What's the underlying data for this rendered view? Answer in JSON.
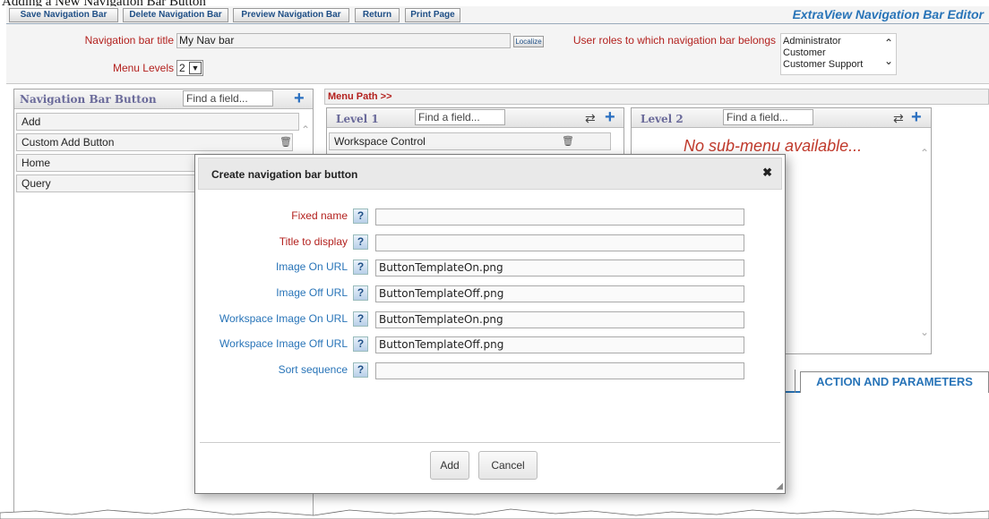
{
  "caption": "Adding a New Navigation Bar Button",
  "toolbar": {
    "buttons": [
      "Save Navigation Bar",
      "Delete Navigation Bar",
      "Preview Navigation Bar",
      "Return",
      "Print Page"
    ],
    "title": "ExtraView Navigation Bar Editor"
  },
  "props": {
    "title_label": "Navigation bar title",
    "title_value": "My Nav bar",
    "localize": "Localize",
    "levels_label": "Menu Levels",
    "levels_value": "2",
    "roles_label": "User roles to which navigation bar belongs",
    "roles": [
      "Administrator",
      "Customer",
      "Customer Support"
    ]
  },
  "left_panel": {
    "title": "Navigation Bar Button",
    "find_placeholder": "Find a field...",
    "items": [
      "Add",
      "Custom Add Button",
      "Home",
      "Query"
    ]
  },
  "menu_path": {
    "label": "Menu Path >>"
  },
  "level1": {
    "title": "Level 1",
    "find_placeholder": "Find a field...",
    "items": [
      "Workspace Control"
    ]
  },
  "level2": {
    "title": "Level 2",
    "find_placeholder": "Find a field...",
    "empty": "No sub-menu available..."
  },
  "tabs": {
    "action": "ACTION AND PARAMETERS"
  },
  "modal": {
    "title": "Create navigation bar button",
    "close": "✖",
    "fields": [
      {
        "label": "Fixed name",
        "value": "",
        "required": true
      },
      {
        "label": "Title to display",
        "value": "",
        "required": true
      },
      {
        "label": "Image On URL",
        "value": "ButtonTemplateOn.png",
        "required": false
      },
      {
        "label": "Image Off URL",
        "value": "ButtonTemplateOff.png",
        "required": false
      },
      {
        "label": "Workspace Image On URL",
        "value": "ButtonTemplateOn.png",
        "required": false
      },
      {
        "label": "Workspace Image Off URL",
        "value": "ButtonTemplateOff.png",
        "required": false
      },
      {
        "label": "Sort sequence",
        "value": "",
        "required": false
      }
    ],
    "help": "?",
    "add": "Add",
    "cancel": "Cancel"
  },
  "colors": {
    "required": "#b3211e",
    "optional": "#2874b8",
    "accent": "#2a6fc0"
  }
}
